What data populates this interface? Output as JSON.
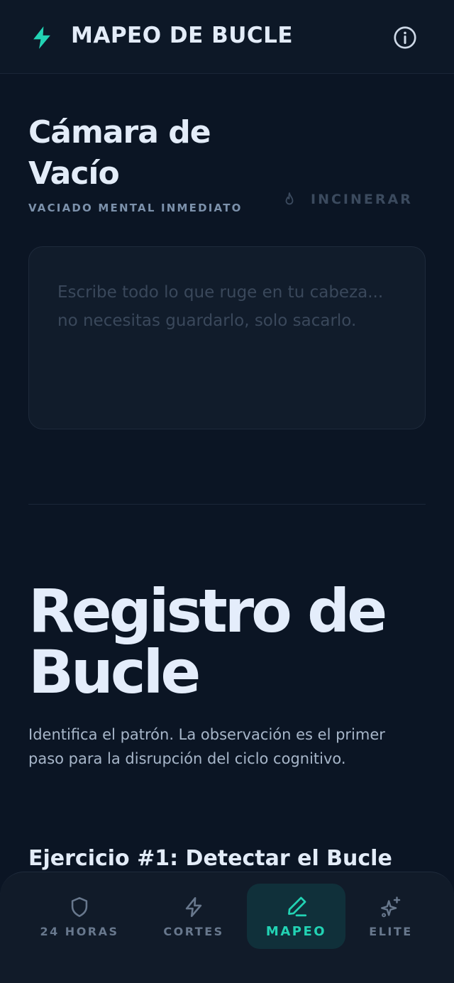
{
  "header": {
    "title": "MAPEO DE BUCLE",
    "brand_icon": "lightning-bolt-icon",
    "info_icon": "info-circle-icon"
  },
  "vacuum_chamber": {
    "title": "Cámara de Vacío",
    "subtitle": "VACIADO MENTAL INMEDIATO",
    "incinerate_label": "INCINERAR",
    "incinerate_icon": "flame-icon",
    "input_value": "",
    "input_placeholder": "Escribe todo lo que ruge en tu cabeza... no necesitas guardarlo, solo sacarlo."
  },
  "loop_log": {
    "title": "Registro de Bucle",
    "description": "Identifica el patrón. La observación es el primer paso para la disrupción del ciclo cognitivo.",
    "exercise_title": "Ejercicio #1: Detectar el Bucle"
  },
  "bottom_nav": {
    "items": [
      {
        "label": "24 HORAS",
        "icon": "shield-icon",
        "active": false
      },
      {
        "label": "CORTES",
        "icon": "lightning-bolt-icon",
        "active": false
      },
      {
        "label": "MAPEO",
        "icon": "pen-icon",
        "active": true
      },
      {
        "label": "ELITE",
        "icon": "sparkles-icon",
        "active": false
      }
    ]
  },
  "colors": {
    "background": "#0b1524",
    "accent": "#22d3b4",
    "text_primary": "#e3ecf8",
    "text_muted": "#7c91ab",
    "nav_inactive": "#68788d"
  }
}
